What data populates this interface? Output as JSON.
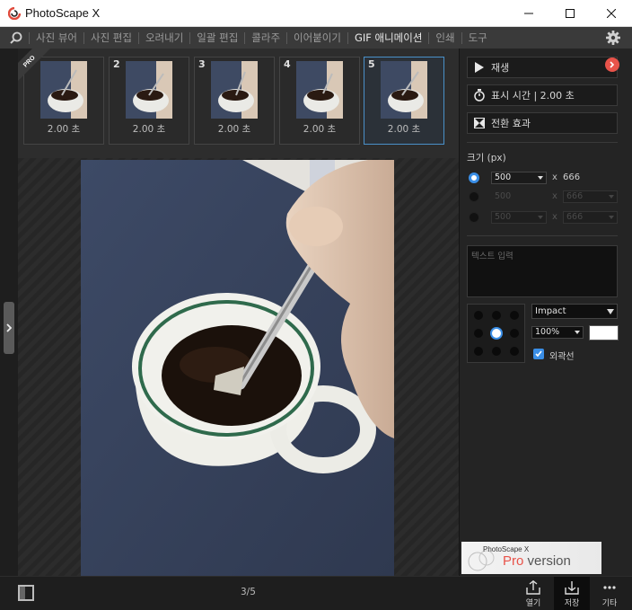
{
  "window": {
    "title": "PhotoScape X",
    "logo_color": "#e04a3c"
  },
  "menu": {
    "items": [
      {
        "label": "사진 뷰어"
      },
      {
        "label": "사진 편집"
      },
      {
        "label": "오려내기"
      },
      {
        "label": "일괄 편집"
      },
      {
        "label": "콜라주"
      },
      {
        "label": "이어붙이기"
      },
      {
        "label": "GIF 애니메이션",
        "active": true
      },
      {
        "label": "인쇄"
      },
      {
        "label": "도구"
      }
    ]
  },
  "frames": [
    {
      "number": "",
      "duration": "2.00 초",
      "selected": false
    },
    {
      "number": "2",
      "duration": "2.00 초",
      "selected": false
    },
    {
      "number": "3",
      "duration": "2.00 초",
      "selected": false
    },
    {
      "number": "4",
      "duration": "2.00 초",
      "selected": false
    },
    {
      "number": "5",
      "duration": "2.00 초",
      "selected": true
    }
  ],
  "pro_ribbon": "PRO",
  "right_panel": {
    "play_label": "재생",
    "display_time_label": "표시 시간 | 2.00 초",
    "transition_label": "전환 효과",
    "size_label": "크기 (px)",
    "size_rows": [
      {
        "width": "500",
        "times": "x",
        "height": "666",
        "active": true
      },
      {
        "width": "500",
        "times": "x",
        "height": "666",
        "active": false
      },
      {
        "width": "500",
        "times": "x",
        "height": "666",
        "active": false
      }
    ],
    "text_placeholder": "텍스트 입력",
    "font_name": "Impact",
    "font_size_pct": "100%",
    "text_color": "#ffffff",
    "outline_label": "외곽선",
    "outline_checked": true,
    "ad": {
      "brand": "PhotoScape X",
      "pro": "Pro",
      "version": " version"
    }
  },
  "bottom": {
    "page_indicator": "3/5",
    "open_label": "열기",
    "save_label": "저장",
    "more_label": "기타"
  },
  "colors": {
    "accent": "#3a8ee6",
    "pro_red": "#e8534a"
  }
}
